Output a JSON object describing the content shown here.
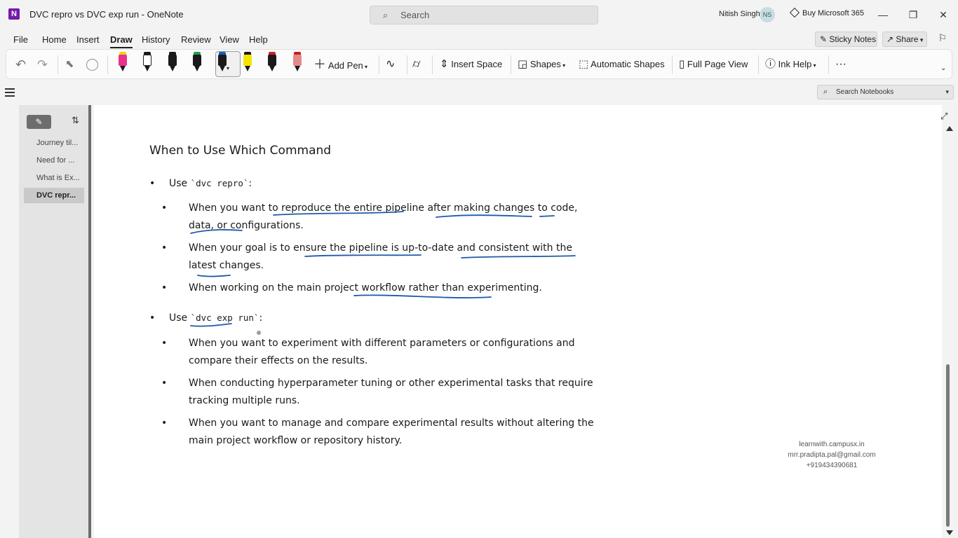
{
  "titlebar": {
    "app_icon_letter": "N",
    "title": "DVC repro vs DVC exp run  -  OneNote",
    "search_placeholder": "Search",
    "user_name": "Nitish Singh",
    "user_initials": "NS",
    "buy_label": "Buy Microsoft 365",
    "controls": {
      "minimize": "—",
      "restore": "❐",
      "close": "✕"
    }
  },
  "menu": {
    "tabs": [
      "File",
      "Home",
      "Insert",
      "Draw",
      "History",
      "Review",
      "View",
      "Help"
    ],
    "active_tab": "Draw",
    "sticky_notes": "Sticky Notes",
    "share": "Share"
  },
  "ribbon": {
    "add_pen": "Add Pen",
    "insert_space": "Insert Space",
    "shapes": "Shapes",
    "automatic_shapes": "Automatic Shapes",
    "full_page_view": "Full Page View",
    "ink_help": "Ink Help",
    "more": "···",
    "pens": [
      {
        "body": "#e8328c",
        "cap": "#e9d800"
      },
      {
        "body": "#ffffff",
        "cap": "#1a1a1a"
      },
      {
        "body": "#1a1a1a",
        "cap": "#1a1a1a"
      },
      {
        "body": "#1a1a1a",
        "cap": "#1aa34a"
      },
      {
        "body": "#1a1a1a",
        "cap": "#1060c0"
      },
      {
        "body": "#f5e400",
        "cap": "#1a1a1a"
      },
      {
        "body": "#1a1a1a",
        "cap": "#d01f2a"
      },
      {
        "body": "#e58a8a",
        "cap": "#c81e1e"
      }
    ]
  },
  "notebook_search": {
    "placeholder": "Search Notebooks"
  },
  "pages": [
    {
      "label": "Journey til...",
      "selected": false
    },
    {
      "label": "Need for ...",
      "selected": false
    },
    {
      "label": "What is Ex...",
      "selected": false
    },
    {
      "label": "DVC repr...",
      "selected": true
    }
  ],
  "note": {
    "heading": "When to Use Which Command",
    "section1": {
      "prefix": "Use ",
      "command": "`dvc repro`",
      "suffix": ":",
      "items": [
        "When you want to reproduce the entire pipeline after making changes to code, data, or configurations.",
        "When your goal is to ensure the pipeline is up-to-date and consistent with the latest changes.",
        "When working on the main project workflow rather than experimenting."
      ]
    },
    "section2": {
      "prefix": "Use ",
      "command": "`dvc exp run`",
      "suffix": ":",
      "items": [
        "When you want to experiment with different parameters or configurations and compare their effects on the results.",
        "When conducting hyperparameter tuning or other experimental tasks that require tracking multiple runs.",
        "When you want to manage and compare experimental results without altering the main project workflow or repository history."
      ]
    }
  },
  "watermark": {
    "line1": "learnwith.campusx.in",
    "line2": "mrr.pradipta.pal@gmail.com",
    "line3": "+919434390681"
  },
  "colors": {
    "ink": "#1f5aa8",
    "app_purple": "#7719aa"
  }
}
